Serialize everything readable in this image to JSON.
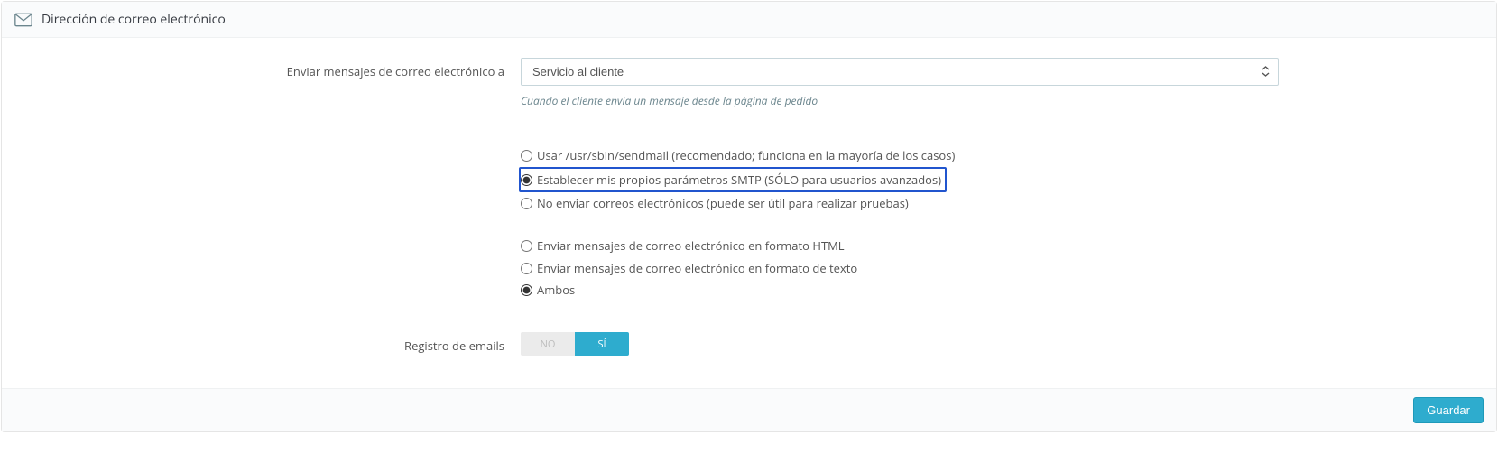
{
  "panel": {
    "title": "Dirección de correo electrónico",
    "saveLabel": "Guardar"
  },
  "fields": {
    "sendTo": {
      "label": "Enviar mensajes de correo electrónico a",
      "selected": "Servicio al cliente",
      "help": "Cuando el cliente envía un mensaje desde la página de pedido"
    },
    "mailMethod": {
      "options": {
        "sendmail": "Usar /usr/sbin/sendmail (recomendado; funciona en la mayoría de los casos)",
        "smtp": "Establecer mis propios parámetros SMTP (SÓLO para usuarios avanzados)",
        "none": "No enviar correos electrónicos (puede ser útil para realizar pruebas)"
      }
    },
    "mailFormat": {
      "options": {
        "html": "Enviar mensajes de correo electrónico en formato HTML",
        "text": "Enviar mensajes de correo electrónico en formato de texto",
        "both": "Ambos"
      }
    },
    "emailLog": {
      "label": "Registro de emails",
      "no": "NO",
      "yes": "SÍ"
    }
  }
}
